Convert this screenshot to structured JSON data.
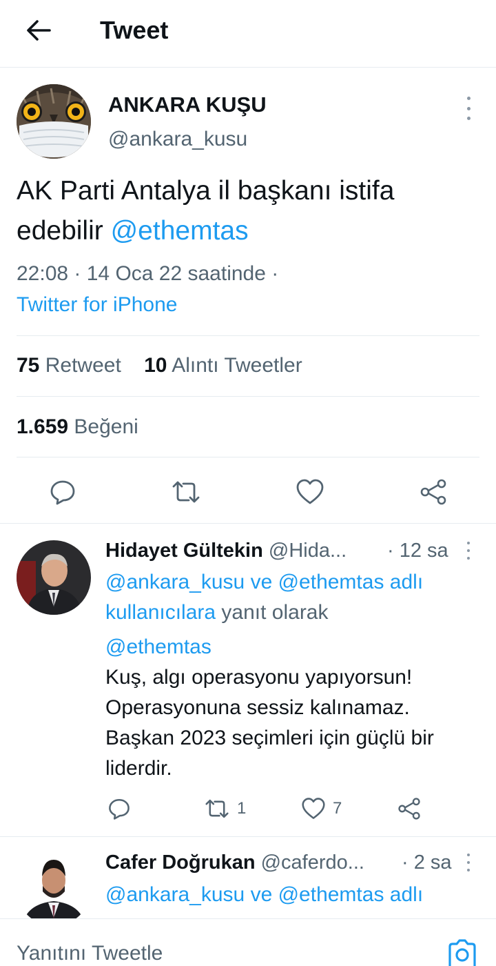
{
  "header": {
    "title": "Tweet",
    "back_icon": "arrow-left-icon"
  },
  "main_tweet": {
    "author_name": "ANKARA KUŞU",
    "author_handle": "@ankara_kusu",
    "text": "AK Parti Antalya il başkanı istifa edebilir",
    "mention": "@ethemtas",
    "timestamp": "22:08 · 14 Oca 22 saatinde ·",
    "source": "Twitter for iPhone",
    "retweet_count": "75",
    "retweet_label": "Retweet",
    "quote_count": "10",
    "quote_label": "Alıntı Tweetler",
    "like_count": "1.659",
    "like_label": "Beğeni",
    "actions": [
      "reply-icon",
      "retweet-icon",
      "heart-icon",
      "share-icon"
    ]
  },
  "replies": [
    {
      "name": "Hidayet Gültekin",
      "handle": "@Hida...",
      "time": "· 12 sa",
      "reply_to_mentions": "@ankara_kusu ve @ethemtas adlı",
      "reply_to_users": "kullanıcılara",
      "reply_to_suffix": " yanıt olarak",
      "mention": "@ethemtas",
      "text": "Kuş, algı operasyonu yapıyorsun! Operasyonuna sessiz kalınamaz. Başkan 2023 seçimleri için güçlü bir liderdir.",
      "retweets": "1",
      "likes": "7"
    },
    {
      "name": "Cafer Doğrukan",
      "handle": "@caferdo...",
      "time": "· 2 sa",
      "reply_to_mentions": "@ankara_kusu ve @ethemtas adlı"
    }
  ],
  "compose": {
    "placeholder": "Yanıtını Tweetle",
    "camera_icon": "camera-icon"
  },
  "colors": {
    "accent": "#1d9bf0",
    "secondary_text": "#536471",
    "primary_text": "#0f1419",
    "divider": "#e6ecf0"
  }
}
